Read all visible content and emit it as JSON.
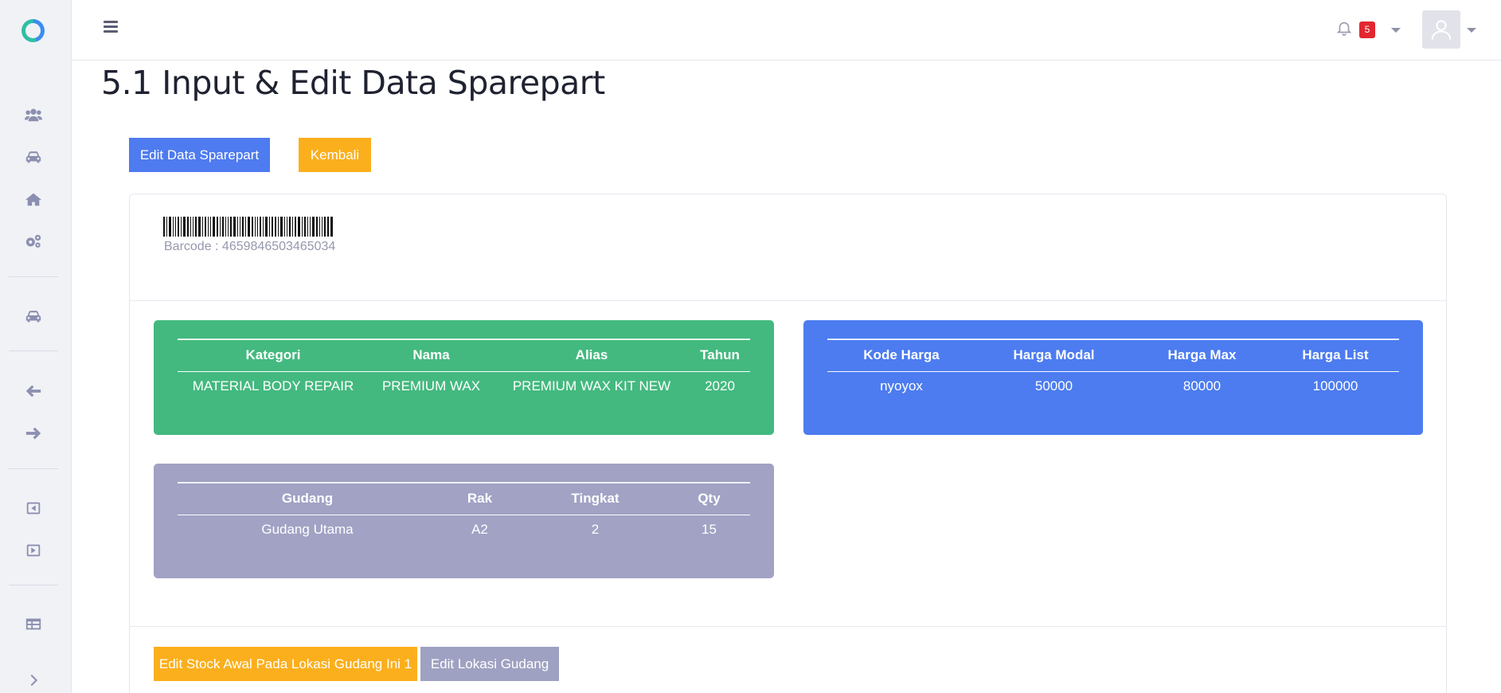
{
  "header": {
    "notification_count": "5"
  },
  "sidebar": {
    "icons": [
      "users-icon",
      "car-icon",
      "home-icon",
      "gears-icon",
      "car-icon",
      "arrow-left-icon",
      "arrow-right-icon",
      "caret-square-left-icon",
      "caret-square-right-icon",
      "table-icon",
      "chevron-right-icon"
    ]
  },
  "page": {
    "title": "5.1 Input & Edit Data Sparepart"
  },
  "actions": {
    "edit_label": "Edit Data Sparepart",
    "back_label": "Kembali"
  },
  "barcode": {
    "text": "Barcode : 4659846503465034"
  },
  "detail_table": {
    "headers": [
      "Kategori",
      "Nama",
      "Alias",
      "Tahun"
    ],
    "row": [
      "MATERIAL BODY REPAIR",
      "PREMIUM WAX",
      "PREMIUM WAX KIT NEW",
      "2020"
    ]
  },
  "price_table": {
    "headers": [
      "Kode Harga",
      "Harga Modal",
      "Harga Max",
      "Harga List"
    ],
    "row": [
      "nyoyox",
      "50000",
      "80000",
      "100000"
    ]
  },
  "stock_table": {
    "headers": [
      "Gudang",
      "Rak",
      "Tingkat",
      "Qty"
    ],
    "row": [
      "Gudang Utama",
      "A2",
      "2",
      "15"
    ]
  },
  "footer_actions": {
    "edit_stock_label": "Edit Stock Awal Pada Lokasi Gudang Ini 1",
    "edit_location_label": "Edit Lokasi Gudang"
  },
  "colors": {
    "green_panel": "#43b97f",
    "blue_panel": "#4c7cf0",
    "gray_panel": "#a1a2c4",
    "primary_button": "#4e7bef",
    "warning_button": "#fbaf1c"
  }
}
